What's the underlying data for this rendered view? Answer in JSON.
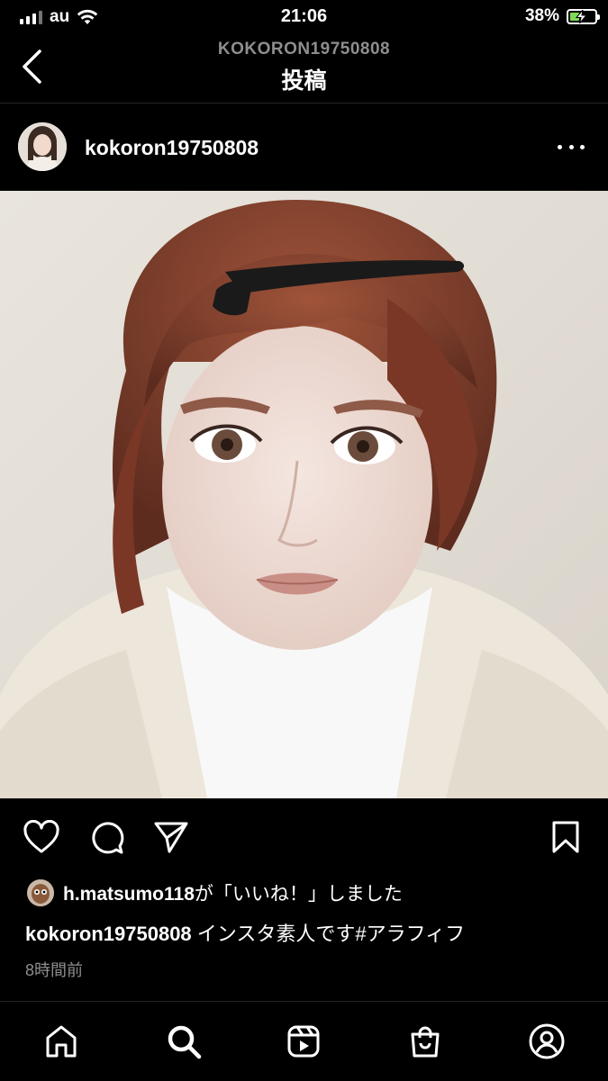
{
  "status_bar": {
    "carrier": "au",
    "time": "21:06",
    "battery_percent": "38%",
    "battery_level": 0.38
  },
  "header": {
    "subtitle": "KOKORON19750808",
    "title": "投稿"
  },
  "post": {
    "username": "kokoron19750808",
    "liked_by_user": "h.matsumo118",
    "liked_by_suffix": "が「いいね！」しました",
    "caption_user": "kokoron19750808",
    "caption_text": " インスタ素人です#アラフィフ",
    "timestamp": "8時間前"
  },
  "icons": {
    "back": "chevron-left-icon",
    "more": "more-horizontal-icon",
    "like": "heart-icon",
    "comment": "comment-icon",
    "share": "send-icon",
    "save": "bookmark-icon",
    "home": "home-icon",
    "search": "search-icon",
    "reels": "reels-icon",
    "shop": "shop-icon",
    "profile": "profile-icon"
  },
  "colors": {
    "background": "#000000",
    "text": "#ffffff",
    "muted": "#8e8e8e",
    "battery": "#7ed957"
  }
}
